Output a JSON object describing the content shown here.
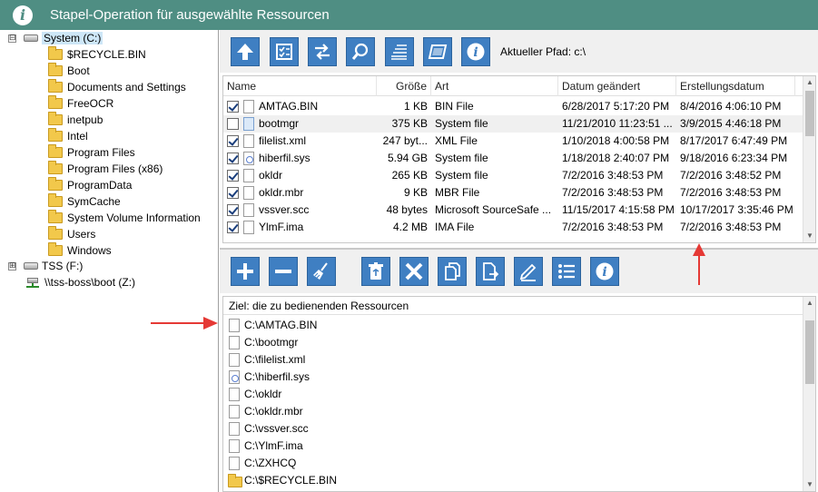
{
  "window": {
    "title": "Stapel-Operation für ausgewählte Ressourcen",
    "title_icon": "info-icon"
  },
  "tree": {
    "root": {
      "label": "System (C:)",
      "expander": "⊟"
    },
    "folders": [
      "$RECYCLE.BIN",
      "Boot",
      "Documents and Settings",
      "FreeOCR",
      "inetpub",
      "Intel",
      "Program Files",
      "Program Files (x86)",
      "ProgramData",
      "SymCache",
      "System Volume Information",
      "Users",
      "Windows"
    ],
    "other_drives": [
      {
        "label": "TSS (F:)",
        "expander": "⊞",
        "icon": "drive-icon"
      },
      {
        "label": "\\\\tss-boss\\boot (Z:)",
        "expander": "",
        "icon": "network-drive-icon"
      }
    ]
  },
  "toolbar_top": {
    "buttons": [
      "up-arrow-icon",
      "checklist-icon",
      "swap-icon",
      "search-icon",
      "filter-lines-icon",
      "window-icon",
      "info-icon"
    ],
    "path_label": "Aktueller Pfad: c:\\"
  },
  "file_table": {
    "columns": [
      "Name",
      "Größe",
      "Art",
      "Datum geändert",
      "Erstellungsdatum"
    ],
    "rows": [
      {
        "checked": true,
        "name": "AMTAG.BIN",
        "size": "1 KB",
        "type": "BIN File",
        "modified": "6/28/2017 5:17:20 PM",
        "created": "8/4/2016 4:06:10 PM"
      },
      {
        "checked": false,
        "name": "bootmgr",
        "size": "375 KB",
        "type": "System file",
        "modified": "11/21/2010 11:23:51 ...",
        "created": "3/9/2015 4:46:18 PM"
      },
      {
        "checked": true,
        "name": "filelist.xml",
        "size": "247 byt...",
        "type": "XML File",
        "modified": "1/10/2018 4:00:58 PM",
        "created": "8/17/2017 6:47:49 PM"
      },
      {
        "checked": true,
        "name": "hiberfil.sys",
        "size": "5.94 GB",
        "type": "System file",
        "modified": "1/18/2018 2:40:07 PM",
        "created": "9/18/2016 6:23:34 PM"
      },
      {
        "checked": true,
        "name": "okldr",
        "size": "265 KB",
        "type": "System file",
        "modified": "7/2/2016 3:48:53 PM",
        "created": "7/2/2016 3:48:52 PM"
      },
      {
        "checked": true,
        "name": "okldr.mbr",
        "size": "9 KB",
        "type": "MBR File",
        "modified": "7/2/2016 3:48:53 PM",
        "created": "7/2/2016 3:48:53 PM"
      },
      {
        "checked": true,
        "name": "vssver.scc",
        "size": "48 bytes",
        "type": "Microsoft SourceSafe ...",
        "modified": "11/15/2017 4:15:58 PM",
        "created": "10/17/2017 3:35:46 PM"
      },
      {
        "checked": true,
        "name": "YlmF.ima",
        "size": "4.2 MB",
        "type": "IMA File",
        "modified": "7/2/2016 3:48:53 PM",
        "created": "7/2/2016 3:48:53 PM"
      }
    ]
  },
  "toolbar_bottom": {
    "buttons": [
      "plus-icon",
      "minus-icon",
      "broom-icon",
      "recycle-bin-icon",
      "close-x-icon",
      "copy-icon",
      "move-file-icon",
      "pencil-icon",
      "list-icon",
      "info-icon"
    ]
  },
  "target_list": {
    "header": "Ziel: die zu bedienenden Ressourcen",
    "items": [
      {
        "path": "C:\\AMTAG.BIN",
        "icon": "file-icon"
      },
      {
        "path": "C:\\bootmgr",
        "icon": "file-icon"
      },
      {
        "path": "C:\\filelist.xml",
        "icon": "file-icon"
      },
      {
        "path": "C:\\hiberfil.sys",
        "icon": "system-file-icon"
      },
      {
        "path": "C:\\okldr",
        "icon": "file-icon"
      },
      {
        "path": "C:\\okldr.mbr",
        "icon": "file-icon"
      },
      {
        "path": "C:\\vssver.scc",
        "icon": "file-icon"
      },
      {
        "path": "C:\\YlmF.ima",
        "icon": "file-icon"
      },
      {
        "path": "C:\\ZXHCQ",
        "icon": "file-icon"
      },
      {
        "path": "C:\\$RECYCLE.BIN",
        "icon": "folder-icon"
      }
    ]
  },
  "colors": {
    "title_bar": "#4f8e83",
    "button": "#3f7fc2",
    "annotation_arrow": "#e53935"
  }
}
